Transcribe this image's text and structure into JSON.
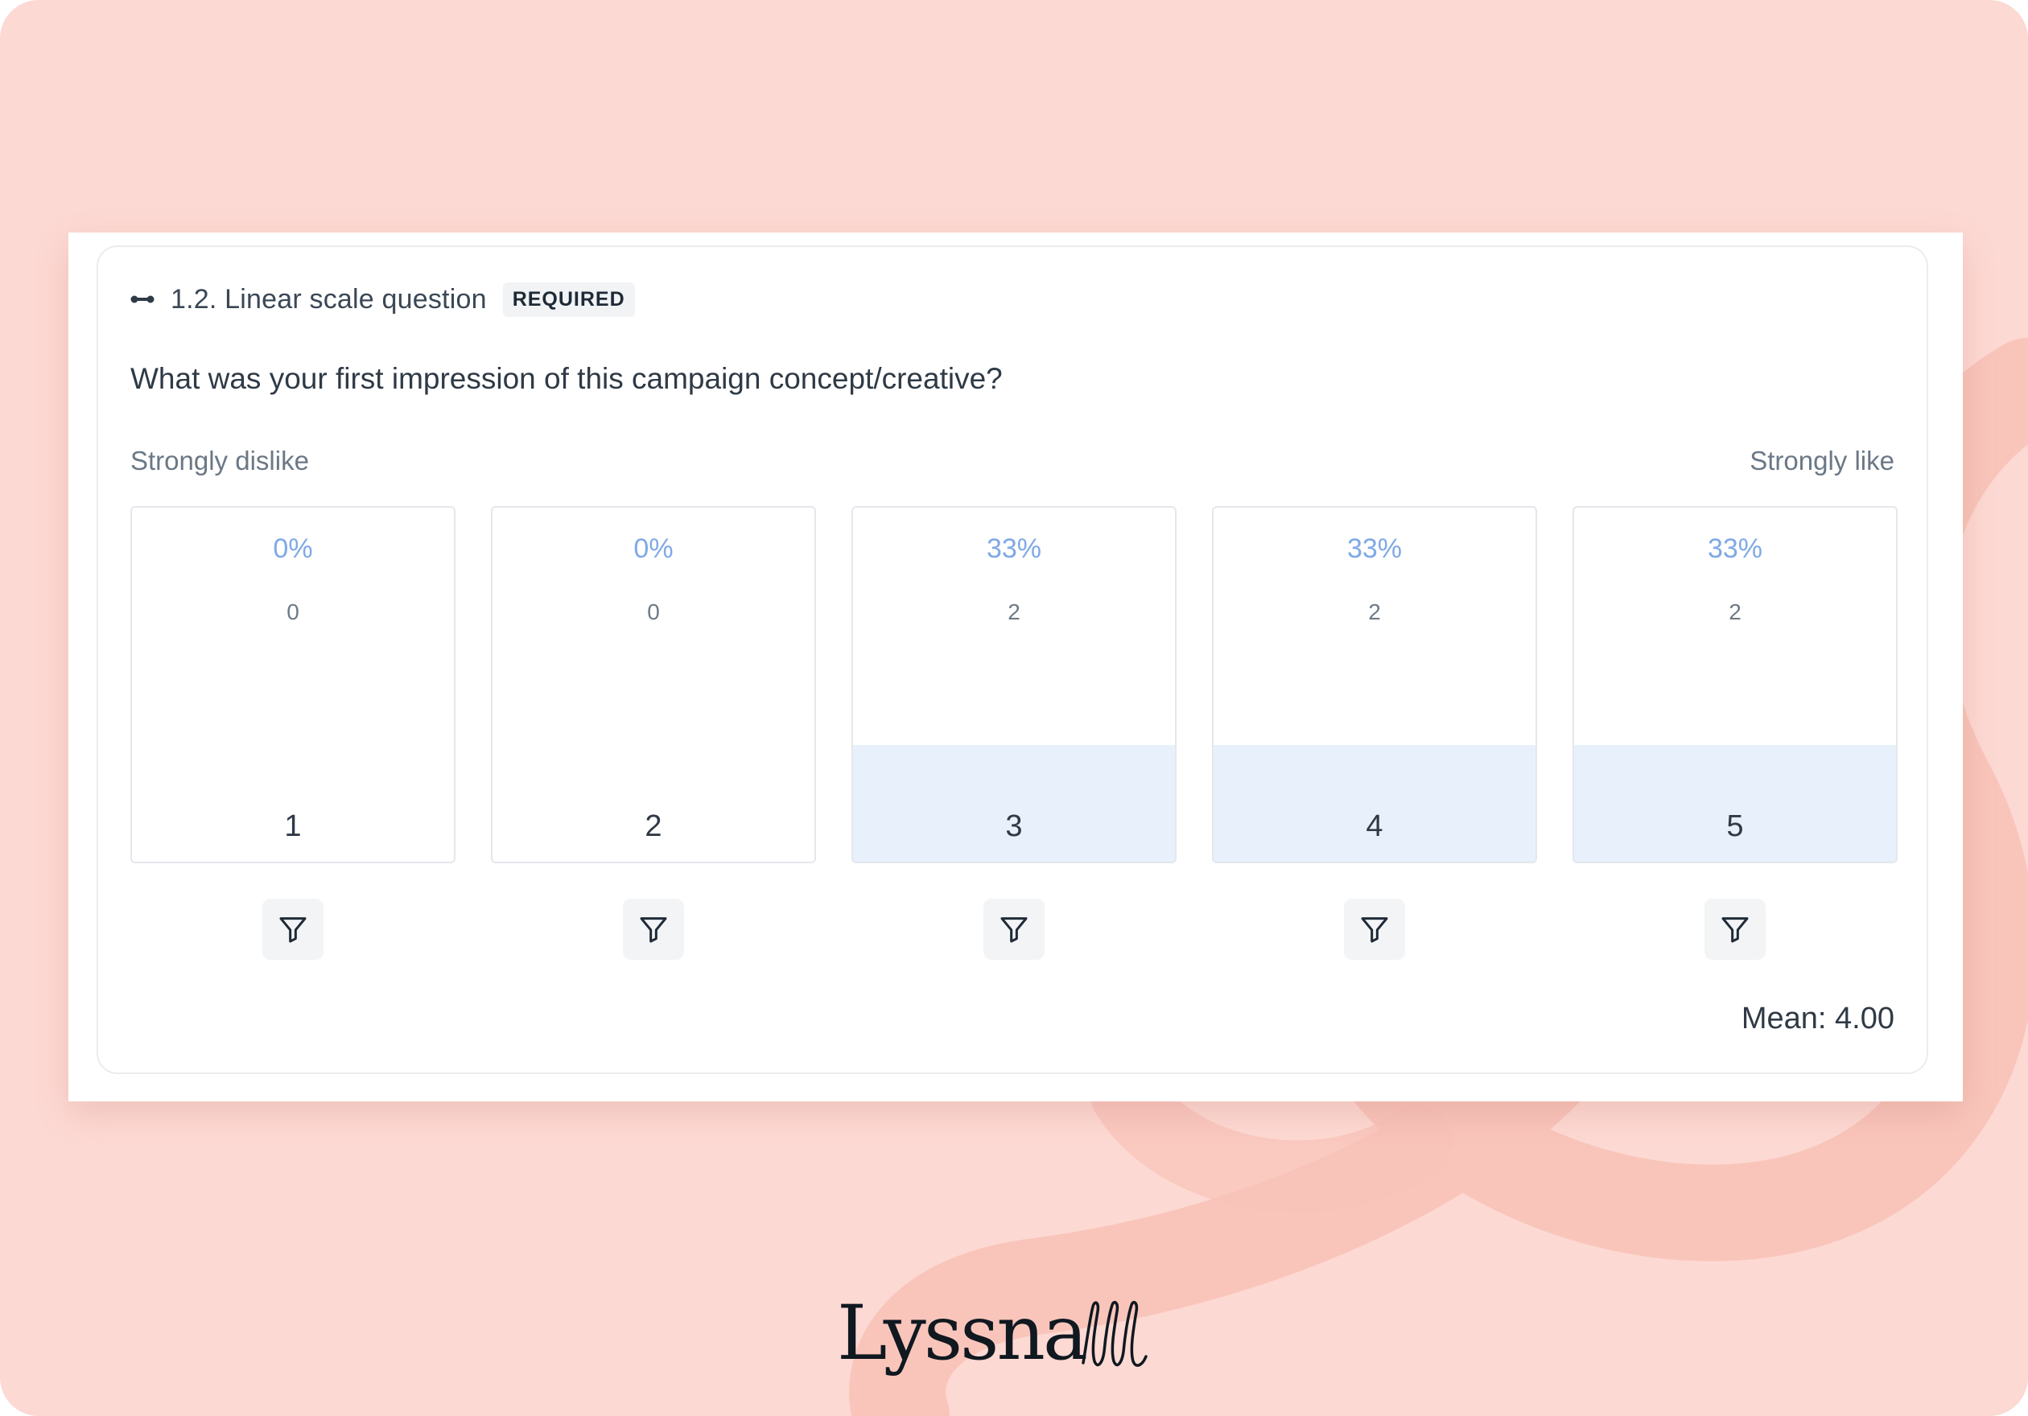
{
  "question": {
    "number_title": "1.2. Linear scale question",
    "badge": "REQUIRED",
    "text": "What was your first impression of this campaign concept/creative?"
  },
  "scale": {
    "left_label": "Strongly dislike",
    "right_label": "Strongly like"
  },
  "options": [
    {
      "value": "1",
      "percent": "0%",
      "count": "0",
      "fill_fraction": 0
    },
    {
      "value": "2",
      "percent": "0%",
      "count": "0",
      "fill_fraction": 0
    },
    {
      "value": "3",
      "percent": "33%",
      "count": "2",
      "fill_fraction": 0.33
    },
    {
      "value": "4",
      "percent": "33%",
      "count": "2",
      "fill_fraction": 0.33
    },
    {
      "value": "5",
      "percent": "33%",
      "count": "2",
      "fill_fraction": 0.33
    }
  ],
  "summary": {
    "mean": "Mean: 4.00"
  },
  "brand": {
    "logo_text": "Lyssna"
  },
  "icons": {
    "question_type": "linear-scale-icon",
    "filter": "filter-icon"
  },
  "colors": {
    "background": "#fdd9d3",
    "bar_fill": "#e8f0fb",
    "percent_text": "#7fa9e6"
  }
}
